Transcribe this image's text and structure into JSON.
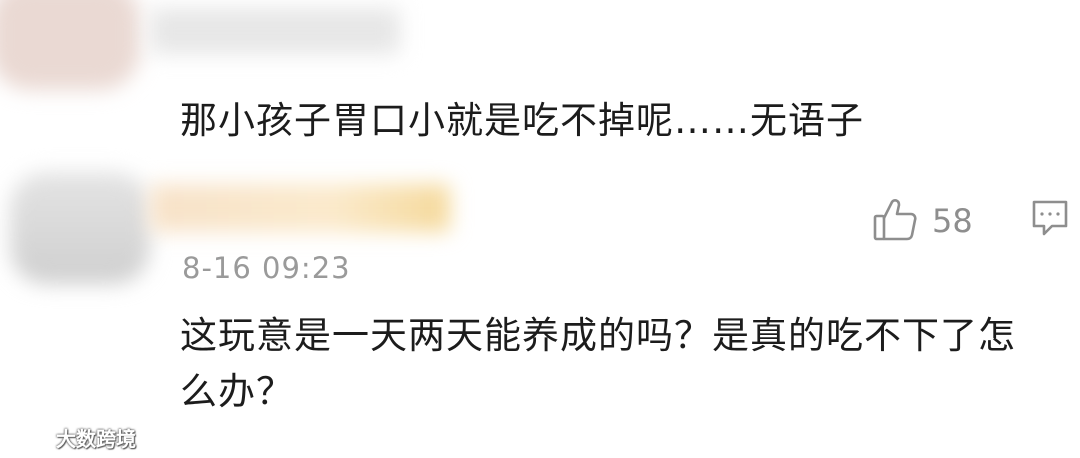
{
  "reply": {
    "text": "那小孩子胃口小就是吃不掉呢……无语子"
  },
  "comment": {
    "like_icon": "thumbs-up-icon",
    "like_count": "58",
    "reply_icon": "comment-icon",
    "timestamp": "8-16 09:23",
    "text": "这玩意是一天两天能养成的吗？是真的吃不下了怎么办？"
  },
  "watermark": {
    "text": "大数跨境"
  },
  "colors": {
    "text": "#1c1c1c",
    "muted": "#8e8e8e",
    "background": "#ffffff"
  }
}
